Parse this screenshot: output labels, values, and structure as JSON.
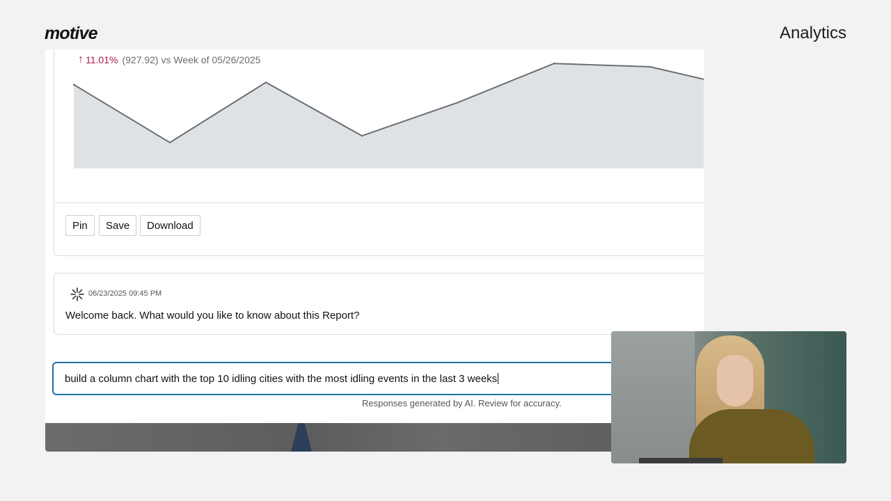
{
  "header": {
    "logo": "motive",
    "title": "Analytics"
  },
  "trend": {
    "percent": "11.01%",
    "detail": "(927.92) vs Week of 05/26/2025"
  },
  "chart_data": {
    "type": "area",
    "x": [
      1,
      2,
      3,
      4,
      5,
      6,
      7,
      8
    ],
    "values": [
      0.74,
      0.22,
      0.76,
      0.28,
      0.58,
      0.93,
      0.9,
      0.7
    ],
    "title": "",
    "xlabel": "",
    "ylabel": "",
    "ylim": [
      0,
      1
    ],
    "grid": false,
    "colors": {
      "line": "#6a6e72",
      "fill": "#dfe2e5"
    }
  },
  "actions": {
    "pin": "Pin",
    "save": "Save",
    "download": "Download"
  },
  "message": {
    "icon": "sparkle-icon",
    "timestamp": "06/23/2025 09:45 PM",
    "text": "Welcome back. What would you like to know about this Report?"
  },
  "prompt": {
    "value": "build a column chart with the top 10 idling cities with the most idling events in the last 3 weeks"
  },
  "disclaimer": "Responses generated by AI. Review for accuracy.",
  "colors": {
    "accent": "#1f6fa6",
    "trend_up": "#b3164f"
  }
}
